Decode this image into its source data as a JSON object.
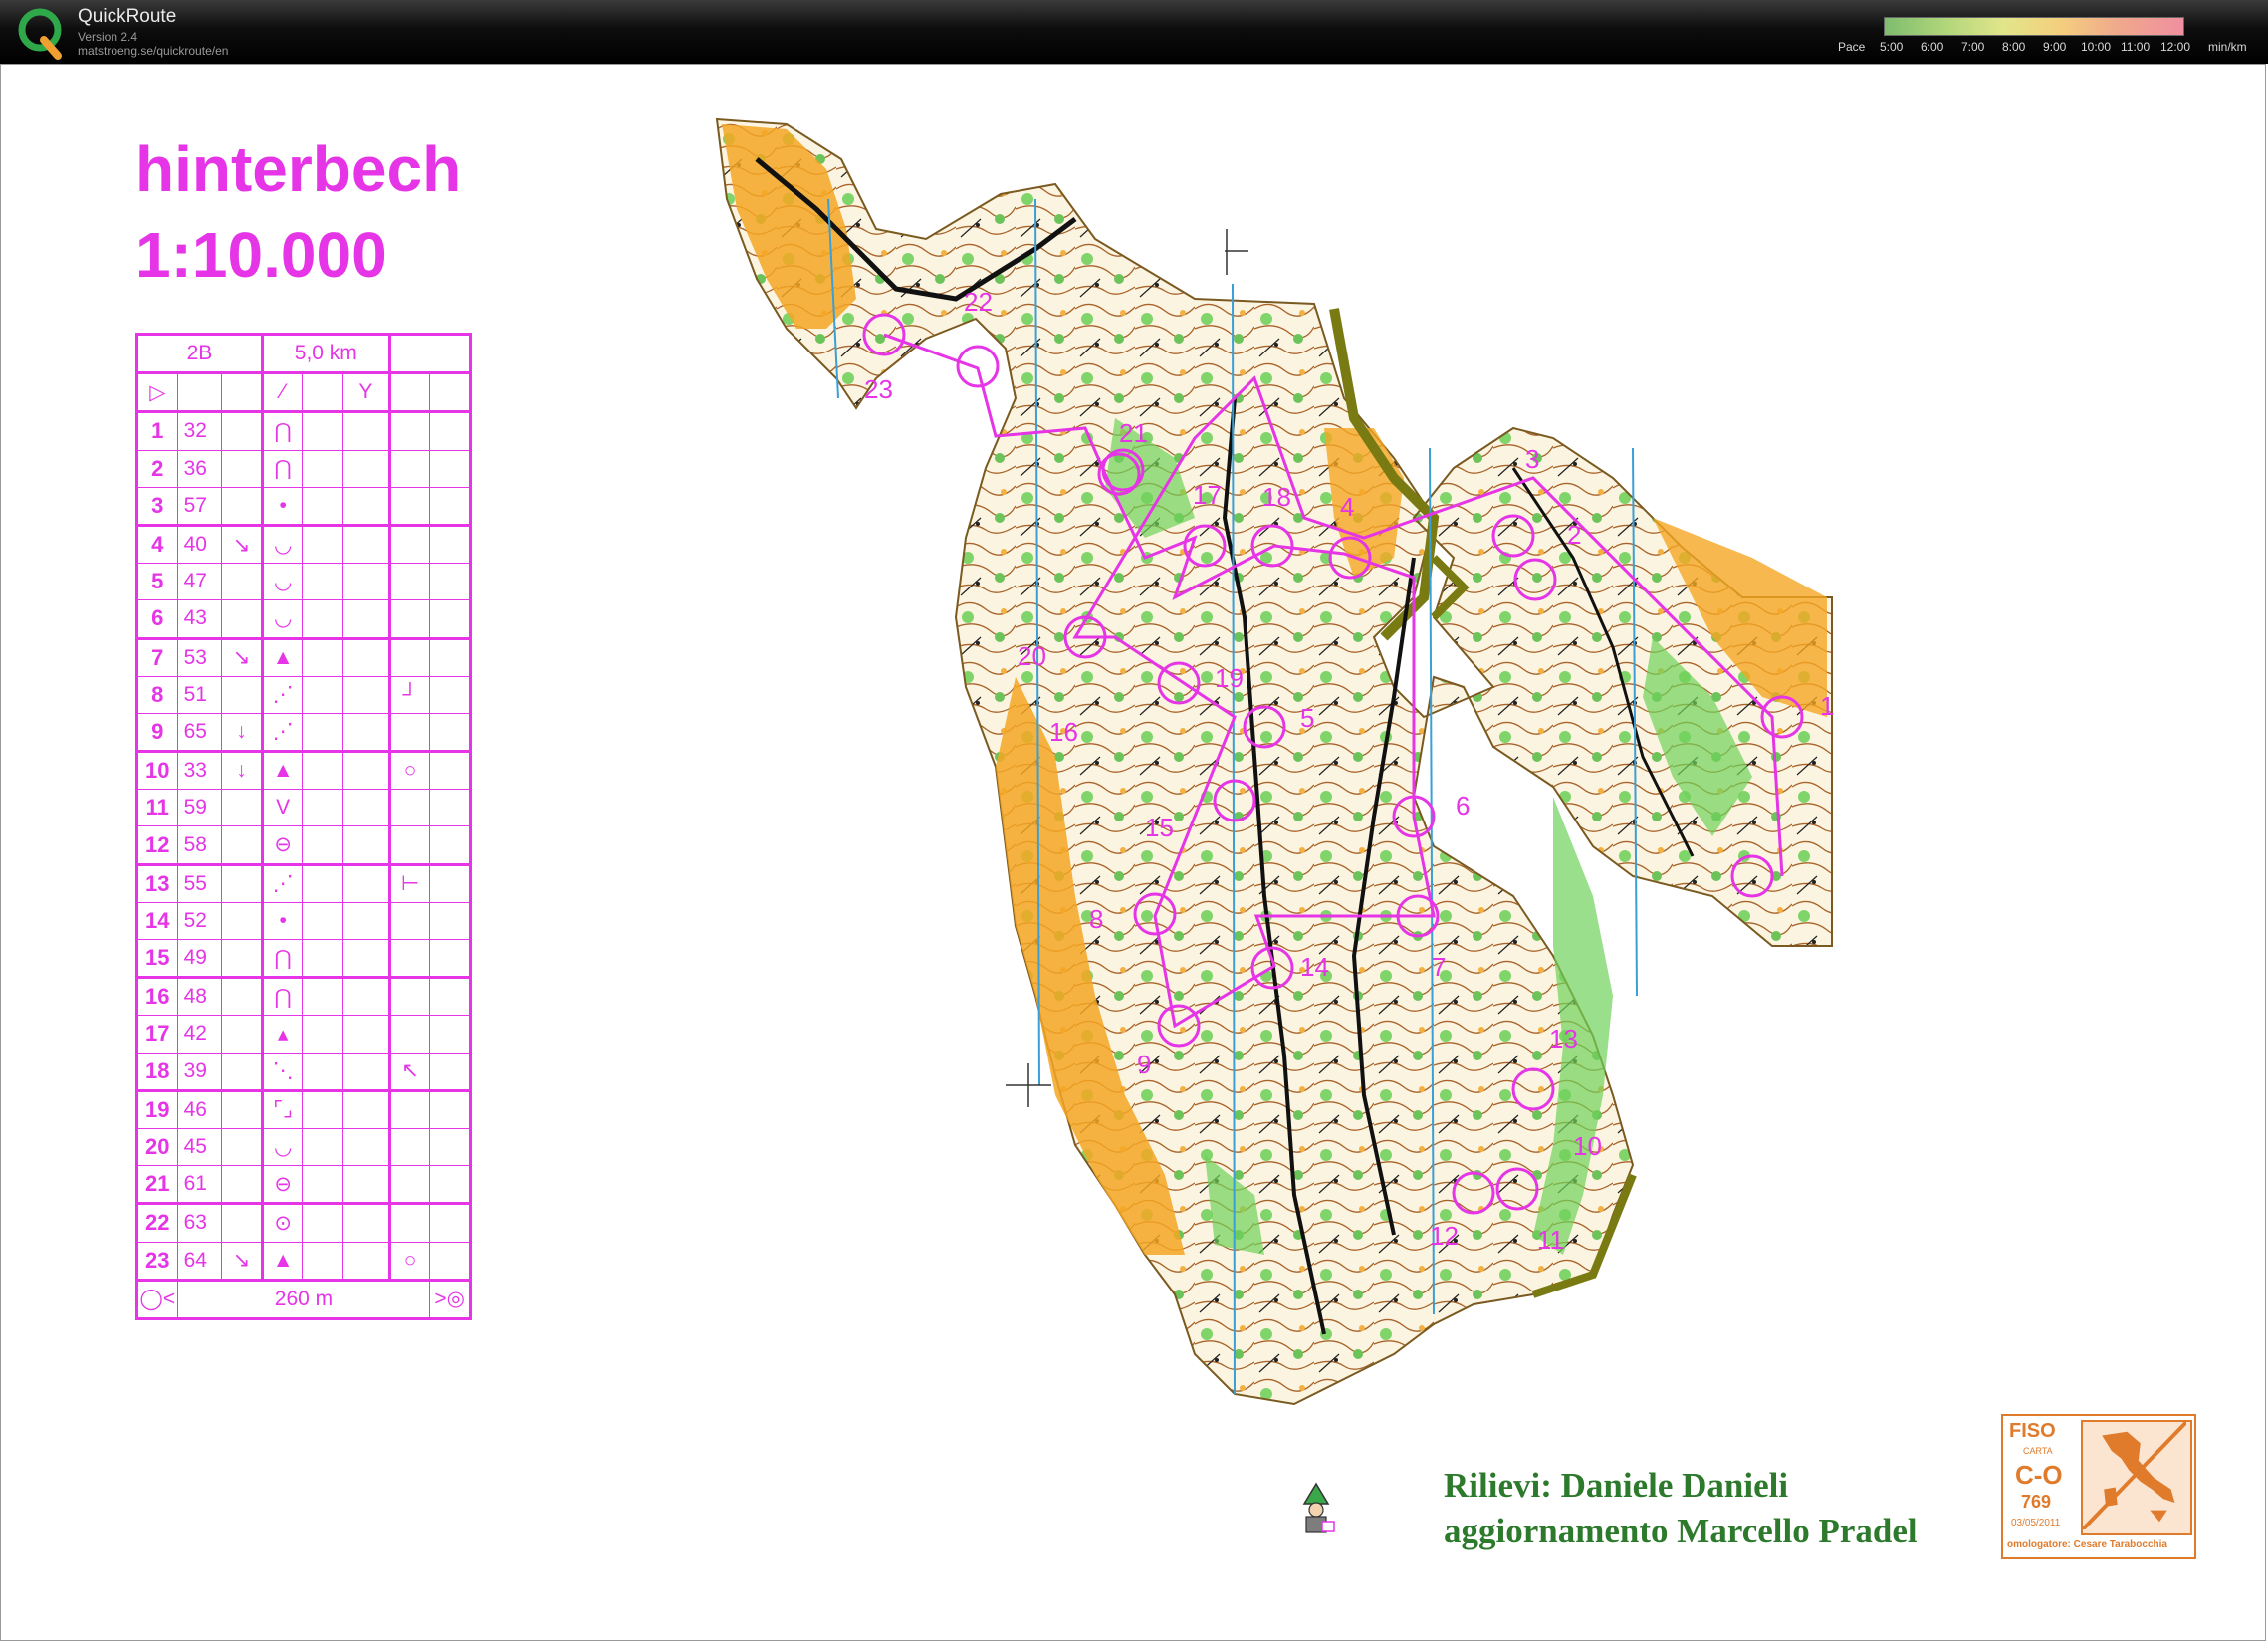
{
  "app": {
    "title": "QuickRoute",
    "version": "Version 2.4",
    "url": "matstroeng.se/quickroute/en"
  },
  "pace_legend": {
    "label": "Pace",
    "ticks": [
      "5:00",
      "6:00",
      "7:00",
      "8:00",
      "9:00",
      "10:00",
      "11:00",
      "12:00"
    ],
    "unit": "min/km"
  },
  "map": {
    "title": "hinterbech",
    "scale": "1:10.000",
    "colors": {
      "course": "#e535e6",
      "forest": "#ffffff",
      "green": "#6fd15a",
      "open": "#f5a623",
      "brown": "#8b4a1c",
      "water": "#3a9fd6"
    }
  },
  "control_descriptions": {
    "course": "2B",
    "length": "5,0 km",
    "finish_distance": "260 m",
    "controls": [
      {
        "n": "1",
        "code": "32",
        "dir": "",
        "symbol": "⋂",
        "extra": ""
      },
      {
        "n": "2",
        "code": "36",
        "dir": "",
        "symbol": "⋂",
        "extra": ""
      },
      {
        "n": "3",
        "code": "57",
        "dir": "",
        "symbol": "•",
        "extra": ""
      },
      {
        "n": "4",
        "code": "40",
        "dir": "↘",
        "symbol": "◡",
        "extra": ""
      },
      {
        "n": "5",
        "code": "47",
        "dir": "",
        "symbol": "◡",
        "extra": ""
      },
      {
        "n": "6",
        "code": "43",
        "dir": "",
        "symbol": "◡",
        "extra": ""
      },
      {
        "n": "7",
        "code": "53",
        "dir": "↘",
        "symbol": "▲",
        "extra": ""
      },
      {
        "n": "8",
        "code": "51",
        "dir": "",
        "symbol": "⋰",
        "extra": "┘"
      },
      {
        "n": "9",
        "code": "65",
        "dir": "↓",
        "symbol": "⋰",
        "extra": ""
      },
      {
        "n": "10",
        "code": "33",
        "dir": "↓",
        "symbol": "▲",
        "extra": "○"
      },
      {
        "n": "11",
        "code": "59",
        "dir": "",
        "symbol": "V",
        "extra": ""
      },
      {
        "n": "12",
        "code": "58",
        "dir": "",
        "symbol": "⊖",
        "extra": ""
      },
      {
        "n": "13",
        "code": "55",
        "dir": "",
        "symbol": "⋰",
        "extra": "⊢"
      },
      {
        "n": "14",
        "code": "52",
        "dir": "",
        "symbol": "•",
        "extra": ""
      },
      {
        "n": "15",
        "code": "49",
        "dir": "",
        "symbol": "⋂",
        "extra": ""
      },
      {
        "n": "16",
        "code": "48",
        "dir": "",
        "symbol": "⋂",
        "extra": ""
      },
      {
        "n": "17",
        "code": "42",
        "dir": "",
        "symbol": "▴",
        "extra": ""
      },
      {
        "n": "18",
        "code": "39",
        "dir": "",
        "symbol": "⋱",
        "extra": "↖"
      },
      {
        "n": "19",
        "code": "46",
        "dir": "",
        "symbol": "⌜⌟",
        "extra": ""
      },
      {
        "n": "20",
        "code": "45",
        "dir": "",
        "symbol": "◡",
        "extra": ""
      },
      {
        "n": "21",
        "code": "61",
        "dir": "",
        "symbol": "⊖",
        "extra": ""
      },
      {
        "n": "22",
        "code": "63",
        "dir": "",
        "symbol": "⊙",
        "extra": ""
      },
      {
        "n": "23",
        "code": "64",
        "dir": "↘",
        "symbol": "▲",
        "extra": "○"
      }
    ]
  },
  "course_labels": [
    "1",
    "2",
    "3",
    "4",
    "5",
    "6",
    "7",
    "8",
    "9",
    "10",
    "11",
    "12",
    "13",
    "14",
    "15",
    "16",
    "17",
    "18",
    "19",
    "20",
    "21",
    "22",
    "23"
  ],
  "credits": {
    "line1": "Rilievi: Daniele Danieli",
    "line2": "aggiornamento Marcello Pradel"
  },
  "fiso_stamp": {
    "title": "FISO",
    "carta": "CARTA",
    "code": "C-O",
    "number": "769",
    "date": "03/05/2011",
    "omologatore": "omologatore: Cesare Tarabocchia"
  }
}
